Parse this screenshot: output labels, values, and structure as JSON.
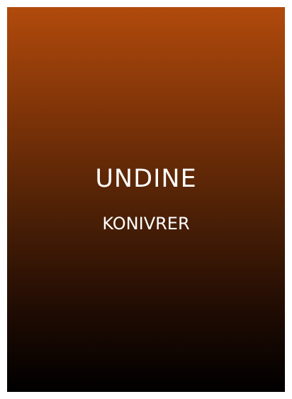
{
  "card": {
    "title": "UNDINE",
    "subtitle": "KONIVRER",
    "gradient_top_color": "#b14a0c",
    "gradient_bottom_color": "#000000",
    "text_color": "#ffffff"
  }
}
